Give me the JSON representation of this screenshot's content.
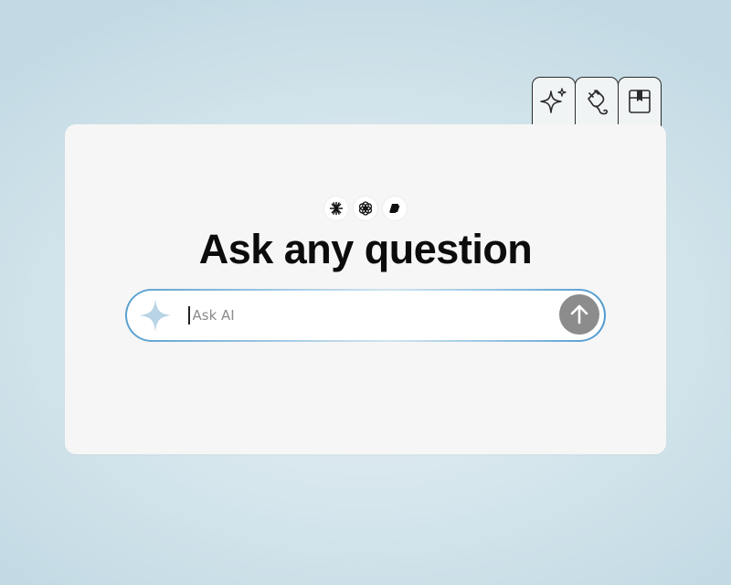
{
  "tabs": [
    {
      "icon": "sparkle-icon"
    },
    {
      "icon": "plug-icon"
    },
    {
      "icon": "box-icon"
    }
  ],
  "providers": [
    {
      "icon": "claude-logo-icon"
    },
    {
      "icon": "openai-logo-icon"
    },
    {
      "icon": "copilot-logo-icon"
    }
  ],
  "headline": "Ask any question",
  "search": {
    "placeholder": "Ask AI",
    "lead_icon": "sparkle-icon",
    "send_icon": "arrow-up-icon"
  },
  "colors": {
    "background": "#d4e5ec",
    "card": "#f6f6f6",
    "search_border_accent": "#5aa0cf",
    "send_button": "#8c8c8c",
    "sparkle": "#b9d4e6"
  }
}
